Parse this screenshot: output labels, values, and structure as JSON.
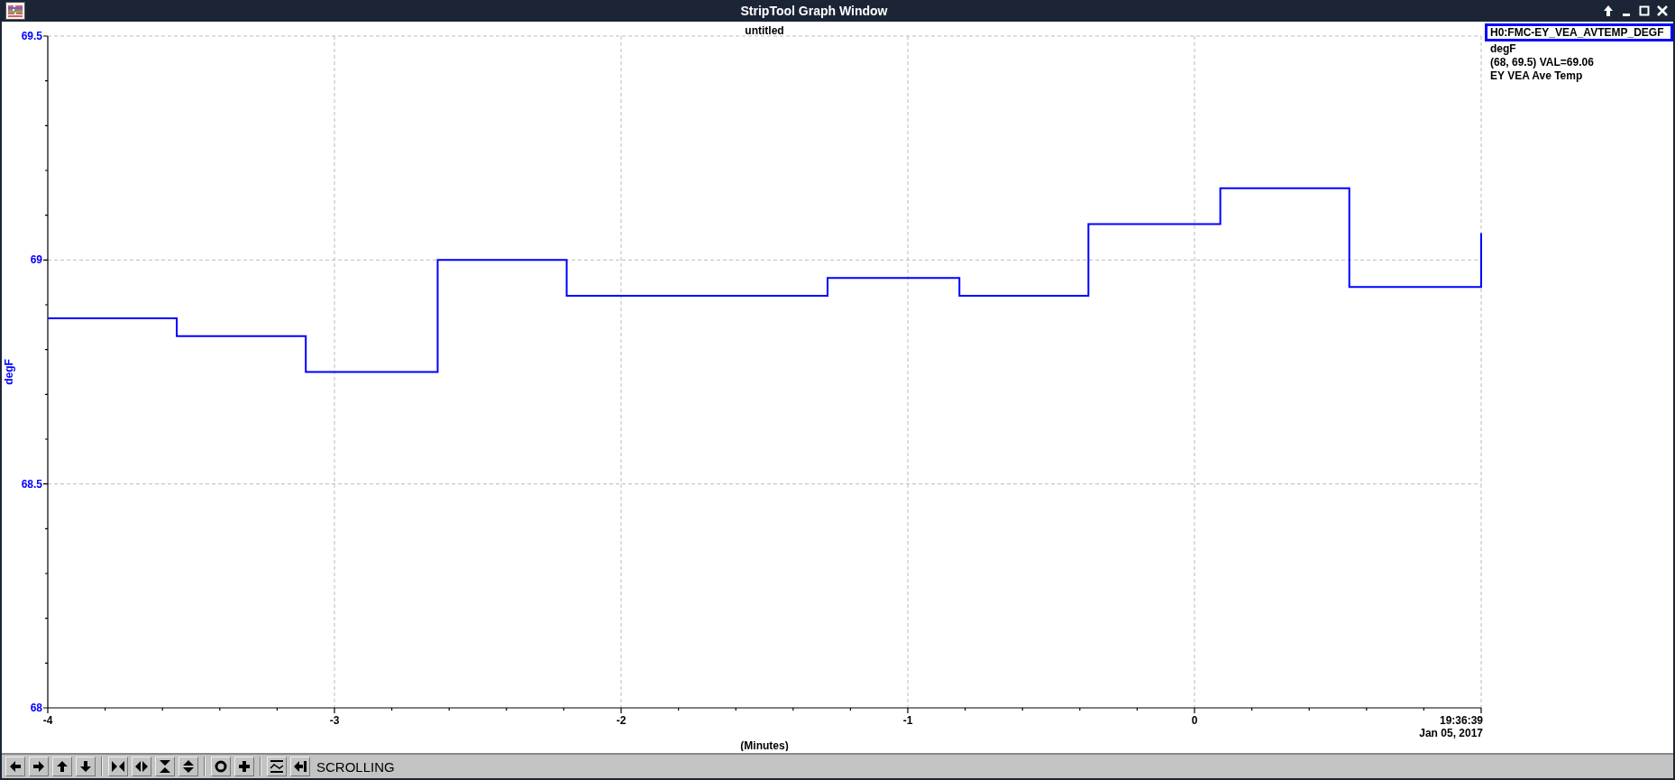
{
  "window": {
    "title": "StripTool Graph Window"
  },
  "graph": {
    "title": "untitled",
    "time_label": {
      "time": "19:36:39",
      "date": "Jan 05, 2017"
    },
    "chart_data": {
      "type": "line",
      "xlabel": "(Minutes)",
      "ylabel": "degF",
      "x": [
        -4,
        -3.55,
        -3.55,
        -3.1,
        -3.1,
        -2.64,
        -2.64,
        -2.19,
        -2.19,
        -1.28,
        -1.28,
        -0.82,
        -0.82,
        -0.37,
        -0.37,
        0.09,
        0.09,
        0.54,
        0.54,
        1.0,
        1.0
      ],
      "series": [
        {
          "name": "H0:FMC-EY_VEA_AVTEMP_DEGF",
          "color": "#0000ff",
          "values": [
            68.87,
            68.87,
            68.83,
            68.83,
            68.75,
            68.75,
            69.0,
            69.0,
            68.92,
            68.92,
            68.96,
            68.96,
            68.92,
            68.92,
            69.08,
            69.08,
            69.16,
            69.16,
            68.94,
            68.94,
            69.06
          ]
        }
      ],
      "xlim": [
        -4,
        1
      ],
      "ylim": [
        68,
        69.5
      ],
      "xticks": [
        -4,
        -3,
        -2,
        -1,
        0
      ],
      "yticks": [
        68,
        68.5,
        69,
        69.5
      ],
      "grid": true
    }
  },
  "legend": [
    {
      "units": "degF",
      "range": "(68, 69.5) VAL=69.06",
      "description": "EY VEA Ave Temp"
    }
  ],
  "status": "SCROLLING"
}
